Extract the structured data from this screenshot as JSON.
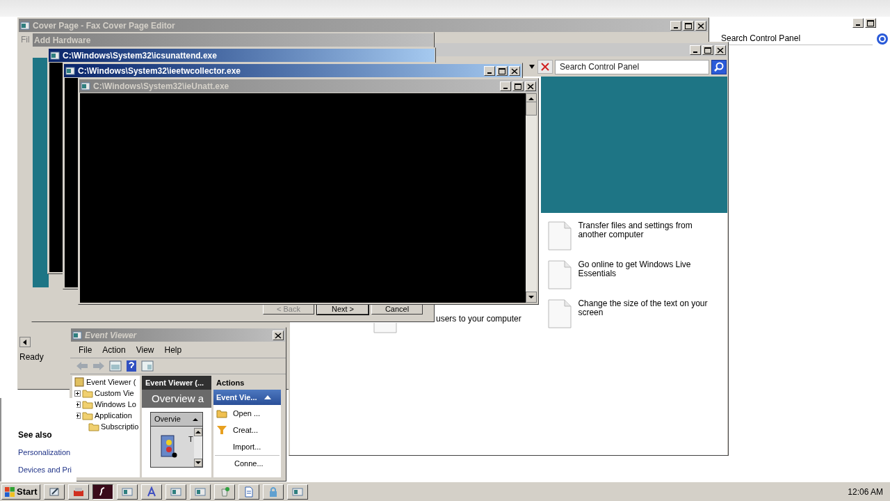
{
  "cover_page_window": {
    "title": "Cover Page - Fax Cover Page Editor",
    "menu": "Fil",
    "status": "Ready"
  },
  "control_panel": {
    "search": {
      "placeholder": "Search Control Panel"
    },
    "tasks": [
      "Transfer files and settings from another computer",
      "Go online to get Windows Live Essentials",
      "Change the size of the text on your screen"
    ],
    "partial_task": "users to your computer",
    "see_also": {
      "title": "See also",
      "links": [
        "Personalization",
        "Devices and Pri"
      ]
    }
  },
  "ghost_search": {
    "placeholder": "Search Control Panel"
  },
  "add_hardware_window": {
    "title": "Add Hardware",
    "buttons": [
      "< Back",
      "Next >",
      "Cancel"
    ]
  },
  "console_windows": [
    {
      "title": "C:\\Windows\\System32\\icsunattend.exe",
      "active": true
    },
    {
      "title": "C:\\Windows\\System32\\ieetwcollector.exe",
      "active": true
    },
    {
      "title": "C:\\Windows\\System32\\ieUnatt.exe",
      "active": false
    }
  ],
  "event_viewer": {
    "title": "Event Viewer",
    "menu": [
      "File",
      "Action",
      "View",
      "Help"
    ],
    "tree": [
      {
        "label": "Event Viewer (",
        "children": [
          {
            "label": "Custom Vie",
            "expanded": false
          },
          {
            "label": "Windows Lo",
            "expanded": false
          },
          {
            "label": "Application",
            "expanded": false
          },
          {
            "label": "Subscriptio"
          }
        ]
      }
    ],
    "center": {
      "header": "Event Viewer (...",
      "heading": "Overview a",
      "section": "Overvie",
      "section_text": "T"
    },
    "actions": {
      "title": "Actions",
      "group": "Event Vie...",
      "items": [
        "Open ...",
        "Creat...",
        "Import...",
        "Conne..."
      ]
    }
  },
  "taskbar": {
    "start": "Start",
    "clock": "12:06 AM",
    "buttons": [
      {
        "selected": false
      },
      {
        "selected": false
      },
      {
        "selected": true
      },
      {
        "selected": false
      },
      {
        "selected": false
      },
      {
        "selected": false
      },
      {
        "selected": false
      },
      {
        "selected": false
      },
      {
        "selected": false
      },
      {
        "selected": false
      },
      {
        "selected": false
      }
    ]
  }
}
